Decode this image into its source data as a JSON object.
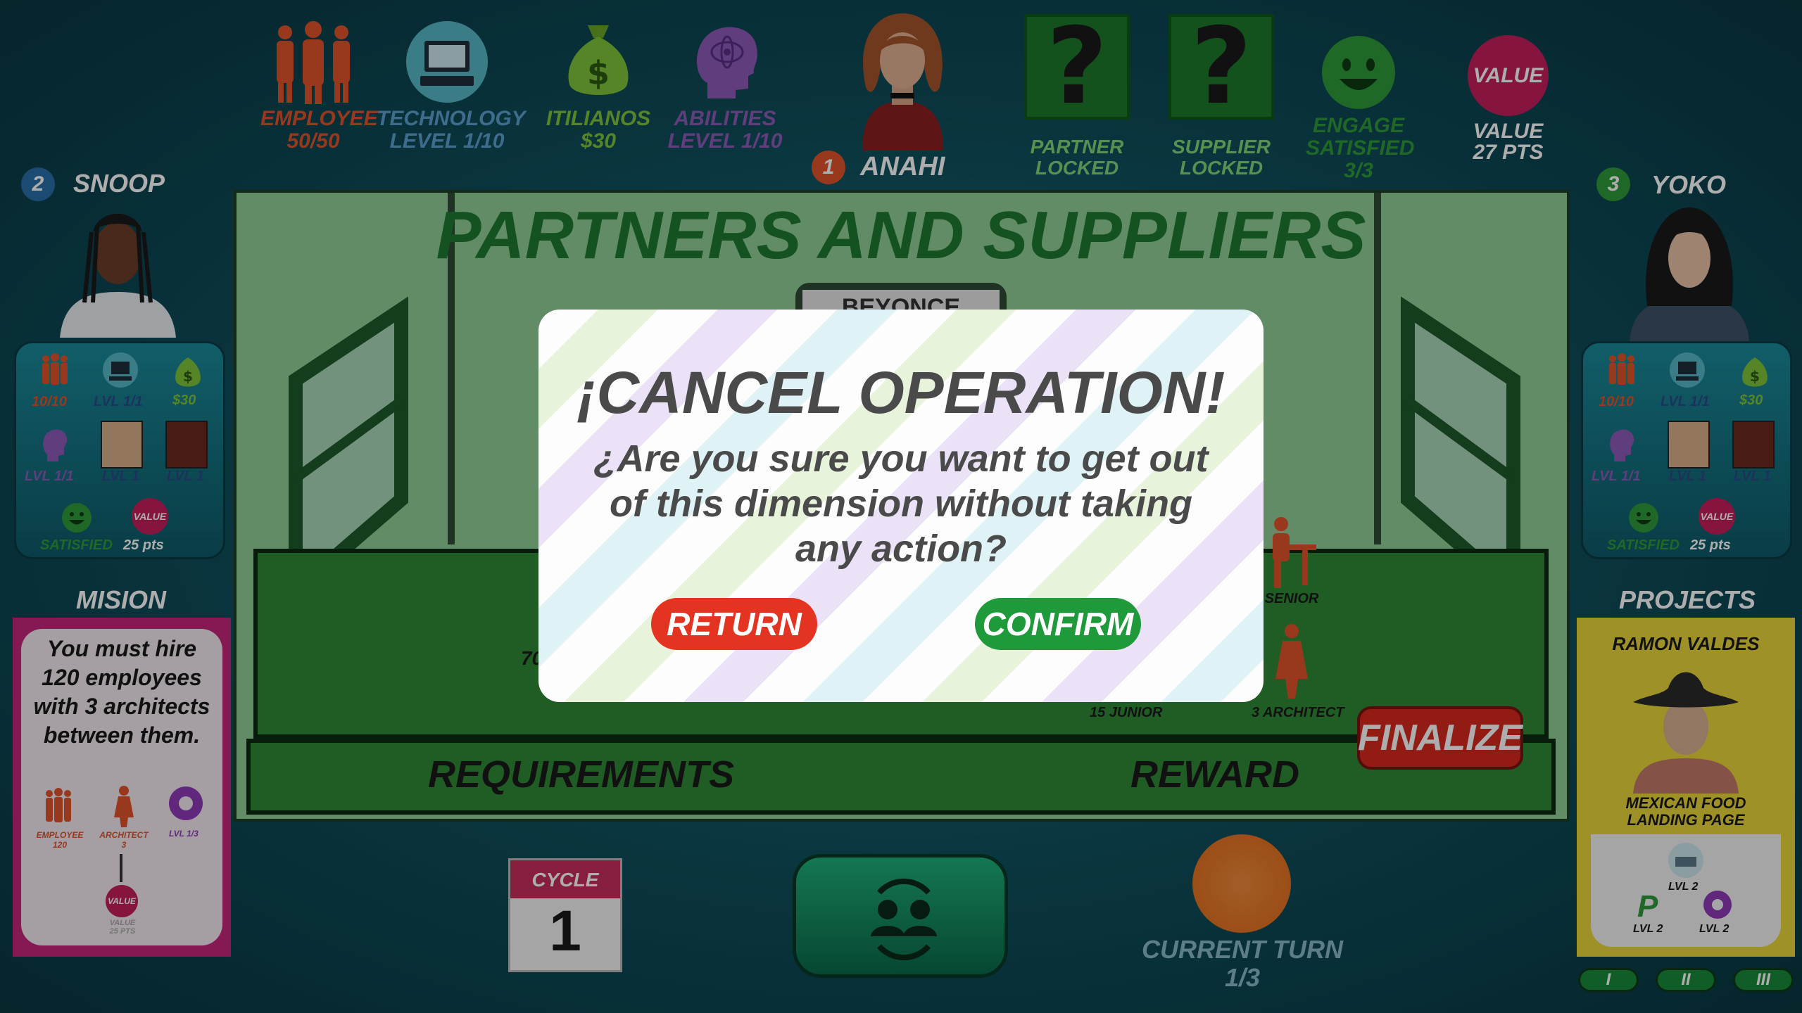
{
  "top_stats": {
    "employee": {
      "label": "EMPLOYEE",
      "value": "50/50"
    },
    "technology": {
      "label": "TECHNOLOGY",
      "value": "LEVEL  1/10"
    },
    "itilianos": {
      "label": "ITILIANOS",
      "value": "$30"
    },
    "abilities": {
      "label": "ABILITIES",
      "value": "LEVEL  1/10"
    },
    "current_player": {
      "number": "1",
      "name": "ANAHI"
    },
    "partner": {
      "label": "PARTNER",
      "status": "LOCKED"
    },
    "supplier": {
      "label": "SUPPLIER",
      "status": "LOCKED"
    },
    "engage": {
      "label": "ENGAGE",
      "label2": "SATISFIED",
      "value": "3/3"
    },
    "value": {
      "badge": "VALUE",
      "label": "VALUE",
      "points": "27 PTS"
    }
  },
  "left_player": {
    "number": "2",
    "name": "SNOOP",
    "stats": {
      "employees": "10/10",
      "tech": "LVL 1/1",
      "money": "$30",
      "ability": "LVL 1/1",
      "card1": "LVL 1",
      "card2": "LVL 1",
      "satisfied": "SATISFIED",
      "value_badge": "VALUE",
      "points": "25 pts"
    }
  },
  "right_player": {
    "number": "3",
    "name": "YOKO",
    "stats": {
      "employees": "10/10",
      "tech": "LVL 1/1",
      "money": "$30",
      "ability": "LVL 1/1",
      "card1": "LVL 1",
      "card2": "LVL 1",
      "satisfied": "SATISFIED",
      "value_badge": "VALUE",
      "points": "25 pts"
    }
  },
  "board": {
    "title": "PARTNERS AND SUPPLIERS",
    "partner_name": "BEYONCE",
    "requirements_label": "REQUIREMENTS",
    "reward_label": "REWARD",
    "senior_label": "5 SENIOR",
    "junior_label": "15 JUNIOR",
    "architect_label": "3 ARCHITECT",
    "partial_number": "70"
  },
  "mission": {
    "heading": "MISION",
    "text": "You must hire 120 employees with 3 architects between them.",
    "employee_label": "EMPLOYEE",
    "employee_count": "120",
    "architect_label": "ARCHITECT",
    "architect_count": "3",
    "level_label": "LVL 1/3",
    "value_badge": "VALUE",
    "reward_label": "VALUE",
    "reward_points": "25 PTS"
  },
  "projects": {
    "heading": "PROJECTS",
    "client": "RAMON VALDES",
    "project_name_1": "MEXICAN FOOD",
    "project_name_2": "LANDING PAGE",
    "tech_level": "LVL 2",
    "p_level": "LVL 2",
    "ability_level": "LVL 2",
    "phases": [
      "I",
      "II",
      "III"
    ]
  },
  "modal": {
    "title": "¡CANCEL OPERATION!",
    "message": "¿Are you sure you want to get out of this dimension without taking any action?",
    "return_label": "RETURN",
    "confirm_label": "CONFIRM"
  },
  "finalize_label": "FINALIZE",
  "cycle": {
    "label": "CYCLE",
    "number": "1"
  },
  "turn": {
    "label": "CURRENT TURN",
    "value": "1/3"
  },
  "colors": {
    "accent_green": "#1e7a32",
    "return_red": "#e53322",
    "confirm_green": "#1e9a3a",
    "finalize_red": "#d8281e"
  }
}
